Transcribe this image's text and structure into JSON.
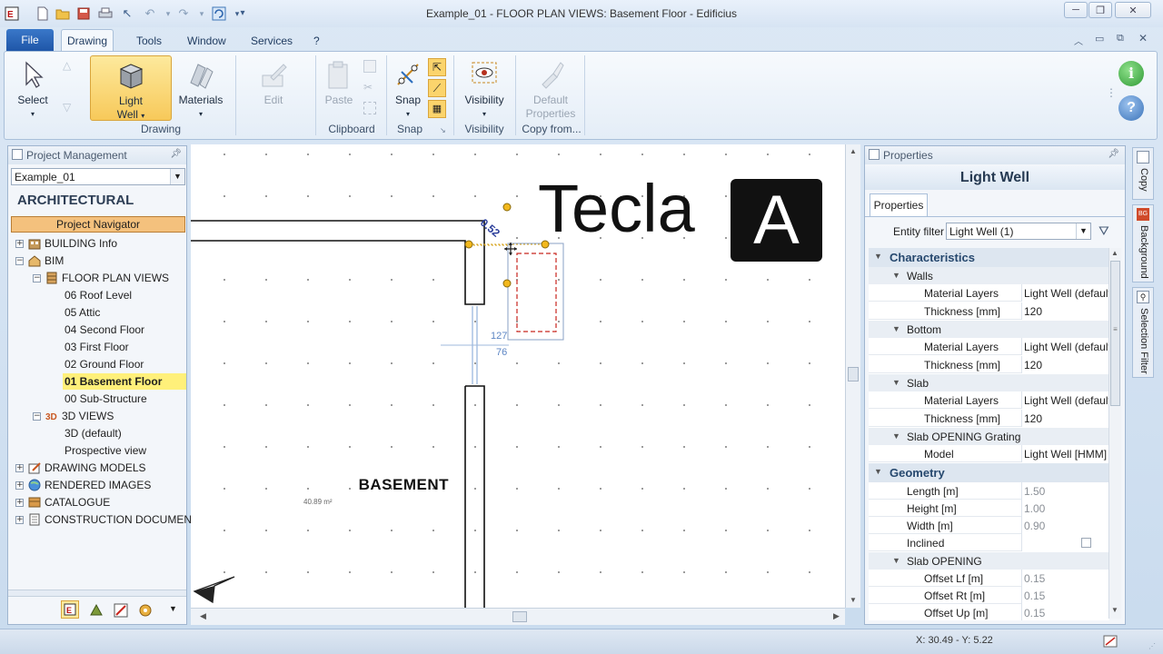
{
  "window": {
    "title": "Example_01 -  FLOOR PLAN VIEWS: Basement Floor - Edificius"
  },
  "menu": {
    "file": "File",
    "tabs": [
      "Drawing",
      "Tools",
      "Window",
      "Services",
      "?"
    ]
  },
  "ribbon": {
    "select": "Select",
    "light_well": [
      "Light",
      "Well"
    ],
    "materials": "Materials",
    "edit": "Edit",
    "paste": "Paste",
    "snap": "Snap",
    "visibility": "Visibility",
    "default_props": [
      "Default",
      "Properties"
    ],
    "groups": {
      "drawing": "Drawing",
      "clipboard": "Clipboard",
      "snap": "Snap",
      "visibility": "Visibility",
      "copy_from": "Copy from..."
    }
  },
  "project": {
    "header": "Project Management",
    "selector": "Example_01",
    "section": "ARCHITECTURAL",
    "navigator": "Project Navigator",
    "tree": {
      "building_info": "BUILDING Info",
      "bim": "BIM",
      "floor_plan_views": "FLOOR PLAN VIEWS",
      "floors": [
        "06 Roof Level",
        "05 Attic",
        "04 Second Floor",
        "03 First Floor",
        "02 Ground Floor",
        "01 Basement Floor",
        "00 Sub-Structure"
      ],
      "views_3d": "3D VIEWS",
      "views_3d_items": [
        "3D (default)",
        "Prospective view"
      ],
      "drawing_models": "DRAWING MODELS",
      "rendered_images": "RENDERED IMAGES",
      "catalogue": "CATALOGUE",
      "construction_docs": "CONSTRUCTION DOCUMENTS S"
    }
  },
  "canvas": {
    "room_name": "BASEMENT",
    "room_area": "40.89 m²",
    "dim_diag": "0.52",
    "dim_a": "127",
    "dim_b": "76",
    "logo_text": "Tecla",
    "logo_letter": "A"
  },
  "properties": {
    "header": "Properties",
    "title": "Light Well",
    "tab": "Properties",
    "entity_filter_label": "Entity filter",
    "entity_filter_value": "Light Well (1)",
    "characteristics": "Characteristics",
    "walls": "Walls",
    "walls_material_label": "Material Layers",
    "walls_material": "Light Well (default)",
    "walls_thickness_label": "Thickness  [mm]",
    "walls_thickness": "120",
    "bottom": "Bottom",
    "bottom_material_label": "Material Layers",
    "bottom_material": "Light Well (default)",
    "bottom_thickness_label": "Thickness  [mm]",
    "bottom_thickness": "120",
    "slab": "Slab",
    "slab_material_label": "Material Layers",
    "slab_material": "Light Well (default)",
    "slab_thickness_label": "Thickness  [mm]",
    "slab_thickness": "120",
    "grating": "Slab OPENING Grating",
    "model_label": "Model",
    "model": "Light Well [HMM] (C",
    "geometry": "Geometry",
    "length_label": "Length  [m]",
    "length": "1.50",
    "height_label": "Height  [m]",
    "height": "1.00",
    "width_label": "Width  [m]",
    "width": "0.90",
    "inclined_label": "Inclined",
    "slab_opening": "Slab OPENING",
    "offset_lf_label": "Offset Lf  [m]",
    "offset_lf": "0.15",
    "offset_rt_label": "Offset Rt  [m]",
    "offset_rt": "0.15",
    "offset_up_label": "Offset Up  [m]",
    "offset_up": "0.15"
  },
  "side_tabs": [
    "Copy",
    "Background",
    "Selection Filter"
  ],
  "status": {
    "coords": "X: 30.49 - Y: 5.22"
  }
}
